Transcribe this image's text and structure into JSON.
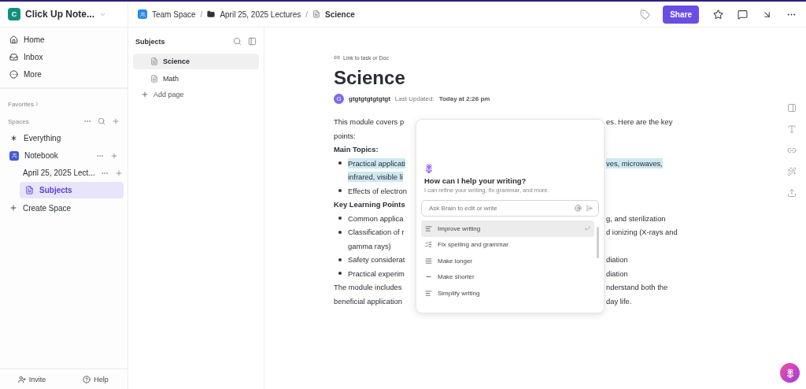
{
  "workspace": {
    "initial": "C",
    "name": "Click Up Note..."
  },
  "breadcrumb": [
    {
      "kind": "space",
      "label": "Team Space"
    },
    {
      "kind": "folder",
      "label": "April 25, 2025 Lectures"
    },
    {
      "kind": "doc",
      "label": "Science"
    }
  ],
  "breadcrumb_separator": "/",
  "share_button": "Share",
  "nav": [
    {
      "kind": "home",
      "label": "Home"
    },
    {
      "kind": "inbox",
      "label": "Inbox"
    },
    {
      "kind": "more",
      "label": "More"
    }
  ],
  "favorites_label": "Favorites",
  "spaces_label": "Spaces",
  "tree": [
    {
      "kind": "everything",
      "label": "Everything",
      "selected": false
    },
    {
      "kind": "space",
      "label": "Notebook",
      "selected": false,
      "children": [
        {
          "kind": "folder",
          "label": "April 25, 2025 Lect...",
          "selected": false,
          "children": [
            {
              "kind": "doc",
              "label": "Subjects",
              "selected": true
            }
          ]
        }
      ]
    }
  ],
  "create_space": "Create Space",
  "footer": [
    {
      "kind": "invite",
      "label": "Invite"
    },
    {
      "kind": "help",
      "label": "Help"
    }
  ],
  "pages_panel": {
    "title": "Subjects",
    "pages": [
      {
        "label": "Science",
        "selected": true
      },
      {
        "label": "Math",
        "selected": false
      }
    ],
    "add": "Add page"
  },
  "doc": {
    "link_label": "Link to task or Doc",
    "title": "Science",
    "author_initial": "G",
    "author": "gtgtgtgtgtgtgt",
    "updated_label": "Last Updated:",
    "updated": "Today at 2:26 pm",
    "lines": [
      {
        "kind": "paragraph",
        "highlighted": false,
        "left": "This module covers p",
        "right": "es. Here are the key"
      },
      {
        "kind": "continuation",
        "highlighted": false,
        "left": "points:"
      },
      {
        "kind": "heading",
        "highlighted": false,
        "left": "Main Topics:"
      },
      {
        "kind": "bullet",
        "highlighted": true,
        "left": "Practical applicati",
        "right": "ves, microwaves,"
      },
      {
        "kind": "continuation",
        "highlighted": true,
        "left": "infrared, visible li"
      },
      {
        "kind": "bullet",
        "highlighted": false,
        "left": "Effects of electron"
      },
      {
        "kind": "heading",
        "highlighted": false,
        "left": "Key Learning Points"
      },
      {
        "kind": "bullet",
        "highlighted": false,
        "left": "Common applica",
        "right": "g, and sterilization"
      },
      {
        "kind": "bullet",
        "highlighted": false,
        "left": "Classification of r",
        "right": "d ionizing (X-rays and"
      },
      {
        "kind": "continuation",
        "highlighted": false,
        "left": "gamma rays)"
      },
      {
        "kind": "bullet",
        "highlighted": false,
        "left": "Safety considerat",
        "right": "diation"
      },
      {
        "kind": "bullet",
        "highlighted": false,
        "left": "Practical experim",
        "right": "diation"
      },
      {
        "kind": "paragraph",
        "highlighted": false,
        "left": "The module includes",
        "right": "nderstand both the"
      },
      {
        "kind": "paragraph",
        "highlighted": false,
        "left": "beneficial application",
        "right": "day life."
      }
    ]
  },
  "ai_popup": {
    "title": "How can I help your writing?",
    "subtitle": "I can refine your writing, fix grammar, and more.",
    "placeholder": "Ask Brain to edit or write",
    "actions": [
      {
        "kind": "improve",
        "label": "Improve writing",
        "selected": true
      },
      {
        "kind": "fix",
        "label": "Fix spelling and grammar",
        "selected": false
      },
      {
        "kind": "longer",
        "label": "Make longer",
        "selected": false
      },
      {
        "kind": "shorter",
        "label": "Make shorter",
        "selected": false
      },
      {
        "kind": "simplify",
        "label": "Simplify writing",
        "selected": false
      }
    ]
  }
}
